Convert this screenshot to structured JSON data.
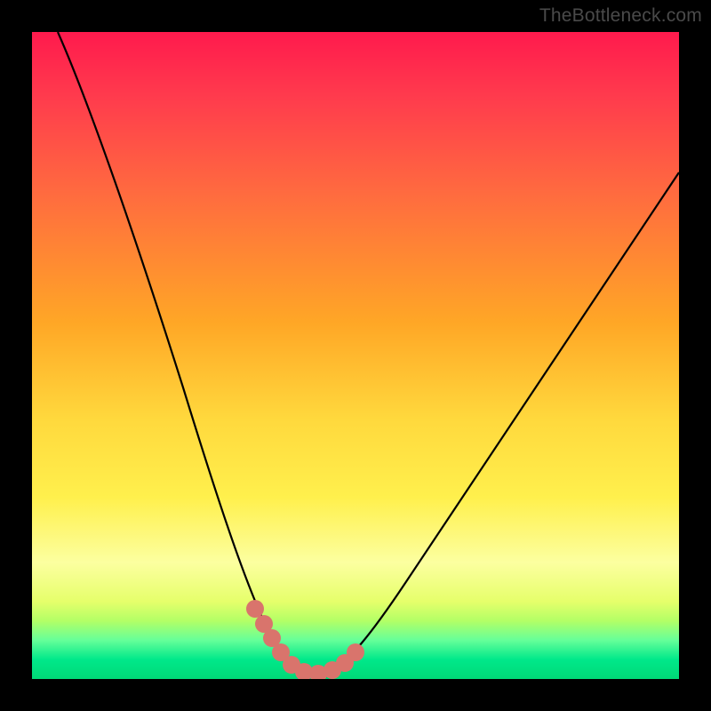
{
  "watermark": "TheBottleneck.com",
  "chart_data": {
    "type": "line",
    "title": "",
    "xlabel": "",
    "ylabel": "",
    "xlim": [
      0,
      100
    ],
    "ylim": [
      0,
      100
    ],
    "series": [
      {
        "name": "bottleneck-curve",
        "x": [
          4,
          8,
          12,
          16,
          20,
          24,
          28,
          31,
          33,
          35,
          37,
          39,
          41,
          43,
          44,
          46,
          48,
          52,
          56,
          62,
          68,
          74,
          80,
          86,
          92,
          98,
          100
        ],
        "values": [
          100,
          92,
          83,
          74,
          64,
          54,
          43,
          33,
          26,
          20,
          14,
          9,
          5,
          3,
          2,
          2,
          3,
          6,
          11,
          19,
          27,
          35,
          43,
          51,
          59,
          67,
          70
        ]
      },
      {
        "name": "highlight-dots",
        "x": [
          33,
          35,
          37,
          39,
          41,
          43,
          44,
          46,
          48
        ],
        "values": [
          26,
          20,
          14,
          9,
          5,
          3,
          2,
          2,
          3
        ]
      }
    ],
    "colors": {
      "curve": "#000000",
      "dots": "#d9746c"
    }
  }
}
